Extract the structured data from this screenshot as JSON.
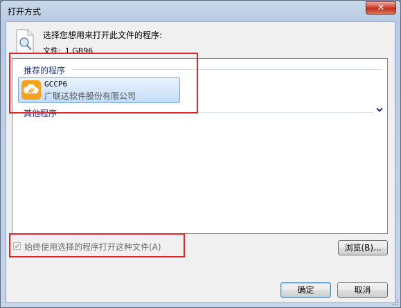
{
  "window": {
    "title": "打开方式",
    "close_label": "✕"
  },
  "dialog": {
    "prompt": "选择您想用来打开此文件的程序:",
    "file_label": "文件:",
    "file_name": "1.GB96"
  },
  "recommended": {
    "header": "推荐的程序",
    "items": [
      {
        "name": "GCCP6",
        "company": "广联达软件股份有限公司",
        "icon": "cloud-link-icon"
      }
    ]
  },
  "other": {
    "header": "其他程序"
  },
  "options": {
    "always_use_label": "始终使用选择的程序打开这种文件(A)",
    "always_use_checked": true,
    "always_use_disabled": true
  },
  "buttons": {
    "browse": "浏览(B)...",
    "ok": "确定",
    "cancel": "取消"
  },
  "colors": {
    "accent_header": "#1e3287",
    "annotation_red": "#e0252b",
    "app_icon_orange": "#f6a21b"
  }
}
